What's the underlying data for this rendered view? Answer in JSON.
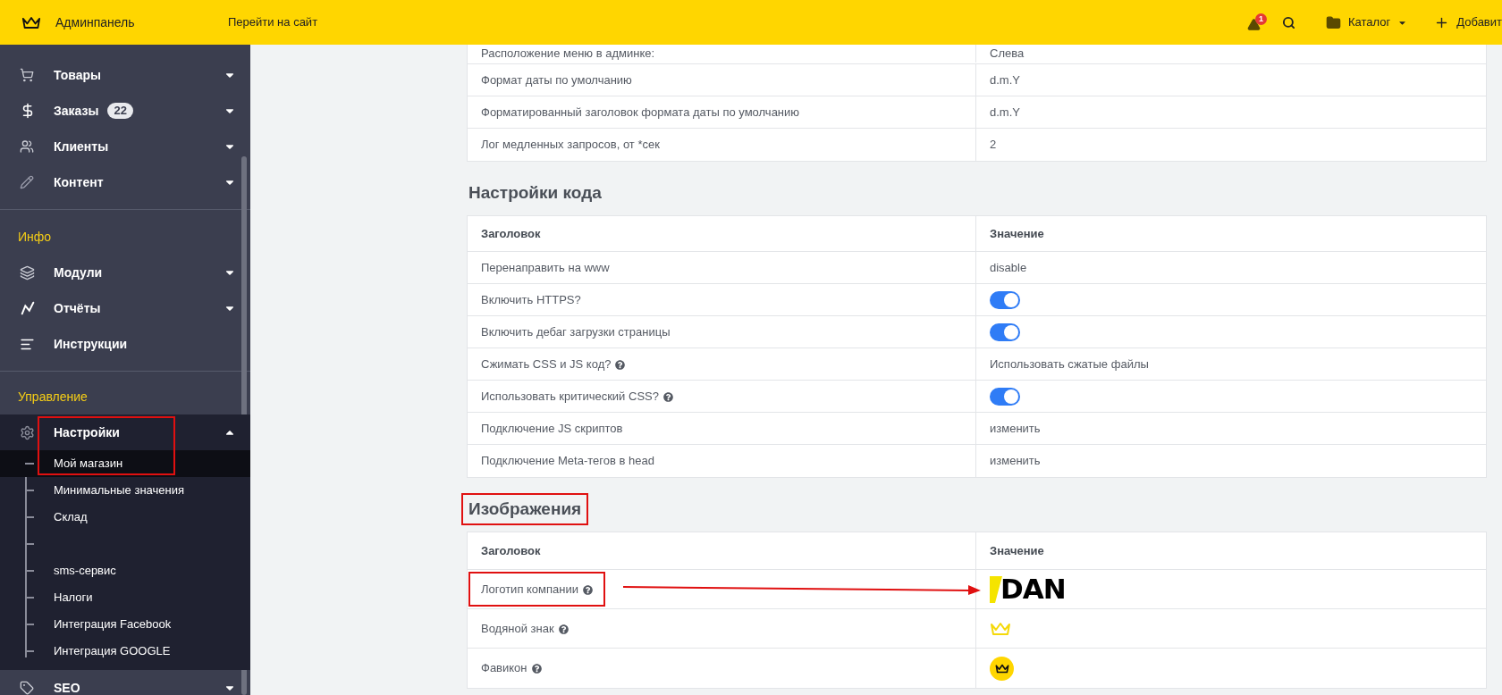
{
  "topbar": {
    "brand": "Админпанель",
    "site_link": "Перейти на сайт",
    "alert_count": "1",
    "catalog": "Каталог",
    "add": "Добавит"
  },
  "sidebar": {
    "sections": [
      {
        "items": [
          {
            "label": "Товары",
            "expanded": false,
            "highlighted": false
          },
          {
            "label": "Заказы",
            "badge": "22",
            "expanded": false,
            "highlighted": false
          },
          {
            "label": "Клиенты",
            "expanded": false,
            "highlighted": false
          },
          {
            "label": "Контент",
            "expanded": false,
            "highlighted": false
          }
        ]
      },
      {
        "title": "Инфо",
        "items": [
          {
            "label": "Модули",
            "expanded": false,
            "highlighted": false
          },
          {
            "label": "Отчёты",
            "expanded": false,
            "highlighted": false
          },
          {
            "label": "Инструкции",
            "highlighted": false
          }
        ]
      },
      {
        "title": "Управление",
        "items": [
          {
            "label": "Настройки",
            "expanded": true,
            "highlighted": true,
            "children": [
              {
                "label": "Мой магазин",
                "selected": true
              },
              {
                "label": "Минимальные значения",
                "selected": false
              },
              {
                "label": "Склад",
                "selected": false
              },
              {
                "selected": false
              },
              {
                "label": "sms-сервис",
                "selected": false
              },
              {
                "label": "Налоги",
                "selected": false
              },
              {
                "label": "Интеграция Facebook",
                "selected": false
              },
              {
                "label": "Интеграция GOOGLE",
                "selected": false
              }
            ]
          }
        ]
      },
      {
        "items": [
          {
            "label": "SEO",
            "expanded": false,
            "highlighted": false
          }
        ]
      }
    ]
  },
  "general_table": {
    "rows": [
      {
        "label": "Расположение меню в админке:",
        "value": "Слева"
      },
      {
        "label": "Формат даты по умолчанию",
        "value": "d.m.Y"
      },
      {
        "label": "Форматированный заголовок формата даты по умолчанию",
        "value": "d.m.Y"
      },
      {
        "label": "Лог медленных запросов, от *сек",
        "value": "2"
      }
    ]
  },
  "code_section": {
    "title": "Настройки кода",
    "highlighted": false,
    "columns": [
      "Заголовок",
      "Значение"
    ],
    "rows": [
      {
        "label": "Перенаправить на www",
        "help": false,
        "kind": "text",
        "value": "disable"
      },
      {
        "label": "Включить HTTPS?",
        "help": false,
        "kind": "toggle",
        "on": true
      },
      {
        "label": "Включить дебаг загрузки страницы",
        "help": false,
        "kind": "toggle",
        "on": true
      },
      {
        "label": "Сжимать CSS и JS код?",
        "help": true,
        "kind": "text",
        "value": "Использовать сжатые файлы"
      },
      {
        "label": "Использовать критический CSS?",
        "help": true,
        "kind": "toggle",
        "on": true
      },
      {
        "label": "Подключение JS скриптов",
        "help": false,
        "kind": "text",
        "value": "изменить"
      },
      {
        "label": "Подключение Meta-тегов в head",
        "help": false,
        "kind": "text",
        "value": "изменить"
      }
    ]
  },
  "images_section": {
    "title": "Изображения",
    "highlighted": true,
    "columns": [
      "Заголовок",
      "Значение"
    ],
    "rows": [
      {
        "label": "Логотип компании",
        "help": true,
        "kind": "logo",
        "logo_text": "DAN",
        "highlighted": true
      },
      {
        "label": "Водяной знак",
        "help": true,
        "kind": "watermark",
        "highlighted": false
      },
      {
        "label": "Фавикон",
        "help": true,
        "kind": "favicon",
        "highlighted": false
      }
    ]
  }
}
